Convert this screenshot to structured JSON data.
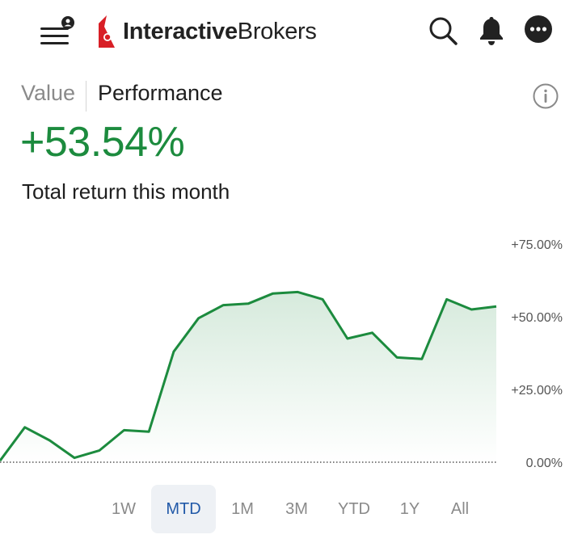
{
  "header": {
    "brand_bold": "Interactive",
    "brand_regular": "Brokers",
    "icons": [
      "menu-icon",
      "profile-badge-icon",
      "ib-logo-icon",
      "search-icon",
      "bell-icon",
      "more-icon"
    ]
  },
  "tabs": {
    "value_label": "Value",
    "performance_label": "Performance",
    "active": "Performance"
  },
  "summary": {
    "value": "+53.54%",
    "label": "Total return this month",
    "color": "#1c8b3e"
  },
  "chart_data": {
    "type": "area",
    "y": [
      0.5,
      12,
      7.5,
      1.5,
      4,
      11,
      10.5,
      38,
      49.5,
      54,
      54.5,
      58,
      58.5,
      56,
      42.5,
      44.5,
      36,
      35.5,
      56,
      52.5,
      53.54
    ],
    "ylim": [
      0,
      75
    ],
    "yticks": [
      "+75.00%",
      "+50.00%",
      "+25.00%",
      "0.00%"
    ],
    "ytick_values": [
      75,
      50,
      25,
      0
    ],
    "line_color": "#1c8b3e",
    "baseline": "dotted",
    "grid": false,
    "y_axis_position": "right"
  },
  "range_buttons": [
    "1W",
    "MTD",
    "1M",
    "3M",
    "YTD",
    "1Y",
    "All"
  ],
  "active_range": "MTD",
  "accent_color": "#2159a8"
}
